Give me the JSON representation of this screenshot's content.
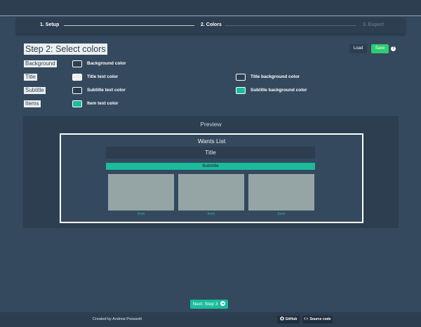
{
  "steps": {
    "step1": "1. Setup",
    "step2": "2. Colors",
    "step3": "3. Export"
  },
  "page_title": "Step 2: Select colors",
  "toolbar": {
    "load_label": "Load",
    "save_label": "Save",
    "help_glyph": "?"
  },
  "rows": {
    "background": "Background",
    "title": "Title",
    "subtitle": "Subtitle",
    "items": "Items"
  },
  "colors": {
    "background_color": {
      "label": "Background color",
      "value": "#2c3e50"
    },
    "title_text_color": {
      "label": "Title text color",
      "value": "#ecf0f1"
    },
    "title_background_color": {
      "label": "Title background color",
      "value": "#2c3e50"
    },
    "subtitle_text_color": {
      "label": "Subtitle text color",
      "value": "#2c3e50"
    },
    "subtitle_background_color": {
      "label": "Subtitle background color",
      "value": "#1abc9c"
    },
    "item_text_color": {
      "label": "Item text color",
      "value": "#1abc9c"
    }
  },
  "preview": {
    "heading": "Preview",
    "list_title": "Wants List",
    "title": "Title",
    "subtitle": "Subtitle",
    "items": [
      "Item",
      "Item",
      "Item"
    ]
  },
  "next_button": "Next: Step 3",
  "footer": {
    "credit": "Created by Andrew Possardt",
    "github": "GitHub",
    "source": "Source code"
  },
  "theme": {
    "page_bg": "#34495e",
    "panel_bg": "#2c3e50",
    "accent": "#1abc9c",
    "save_green": "#2ecc71"
  }
}
